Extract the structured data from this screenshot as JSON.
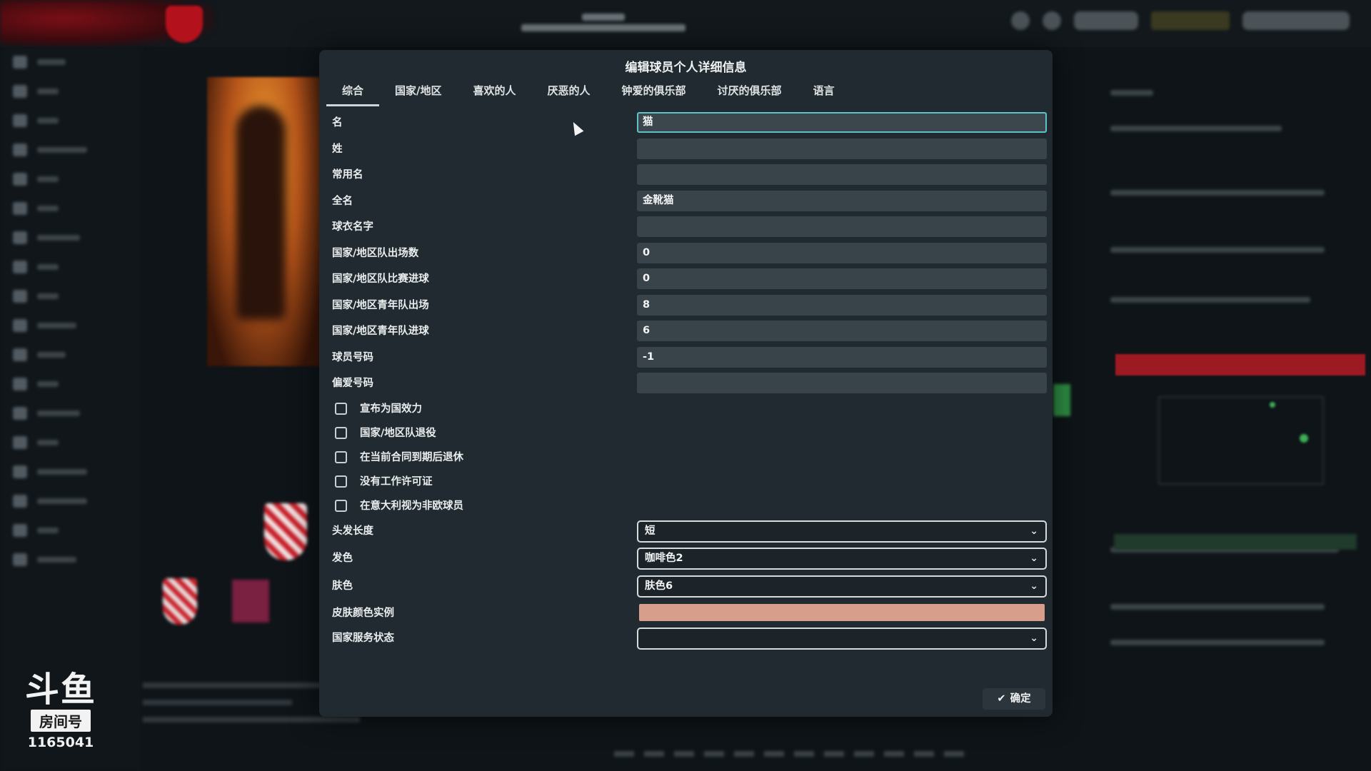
{
  "dialog": {
    "title": "编辑球员个人详细信息",
    "tabs": [
      "综合",
      "国家/地区",
      "喜欢的人",
      "厌恶的人",
      "钟爱的俱乐部",
      "讨厌的俱乐部",
      "语言"
    ],
    "active_tab": "综合",
    "fields": [
      {
        "label": "名",
        "value": "猫"
      },
      {
        "label": "姓",
        "value": ""
      },
      {
        "label": "常用名",
        "value": ""
      },
      {
        "label": "全名",
        "value": "金靴猫"
      },
      {
        "label": "球衣名字",
        "value": ""
      },
      {
        "label": "国家/地区队出场数",
        "value": "0"
      },
      {
        "label": "国家/地区队比赛进球",
        "value": "0"
      },
      {
        "label": "国家/地区青年队出场",
        "value": "8"
      },
      {
        "label": "国家/地区青年队进球",
        "value": "6"
      },
      {
        "label": "球员号码",
        "value": "-1"
      },
      {
        "label": "偏爱号码",
        "value": ""
      }
    ],
    "checkboxes": [
      {
        "label": "宣布为国效力",
        "checked": false
      },
      {
        "label": "国家/地区队退役",
        "checked": false
      },
      {
        "label": "在当前合同到期后退休",
        "checked": false
      },
      {
        "label": "没有工作许可证",
        "checked": false
      },
      {
        "label": "在意大利视为非欧球员",
        "checked": false
      }
    ],
    "selects": {
      "hair_length": {
        "label": "头发长度",
        "value": "短"
      },
      "hair_color": {
        "label": "发色",
        "value": "咖啡色2"
      },
      "skin_tone": {
        "label": "肤色",
        "value": "肤色6"
      },
      "skin_sample": {
        "label": "皮肤颜色实例",
        "color": "#d69e8b"
      },
      "national_service": {
        "label": "国家服务状态",
        "value": ""
      }
    },
    "confirm_label": "确定"
  },
  "watermark": {
    "logo": "斗鱼",
    "label": "房间号",
    "room_number": "1165041"
  },
  "colors": {
    "dialog_bg": "#202a30",
    "field_bg": "#39434a",
    "focus_border": "#5ec3c6",
    "skin_sample": "#d69e8b"
  }
}
